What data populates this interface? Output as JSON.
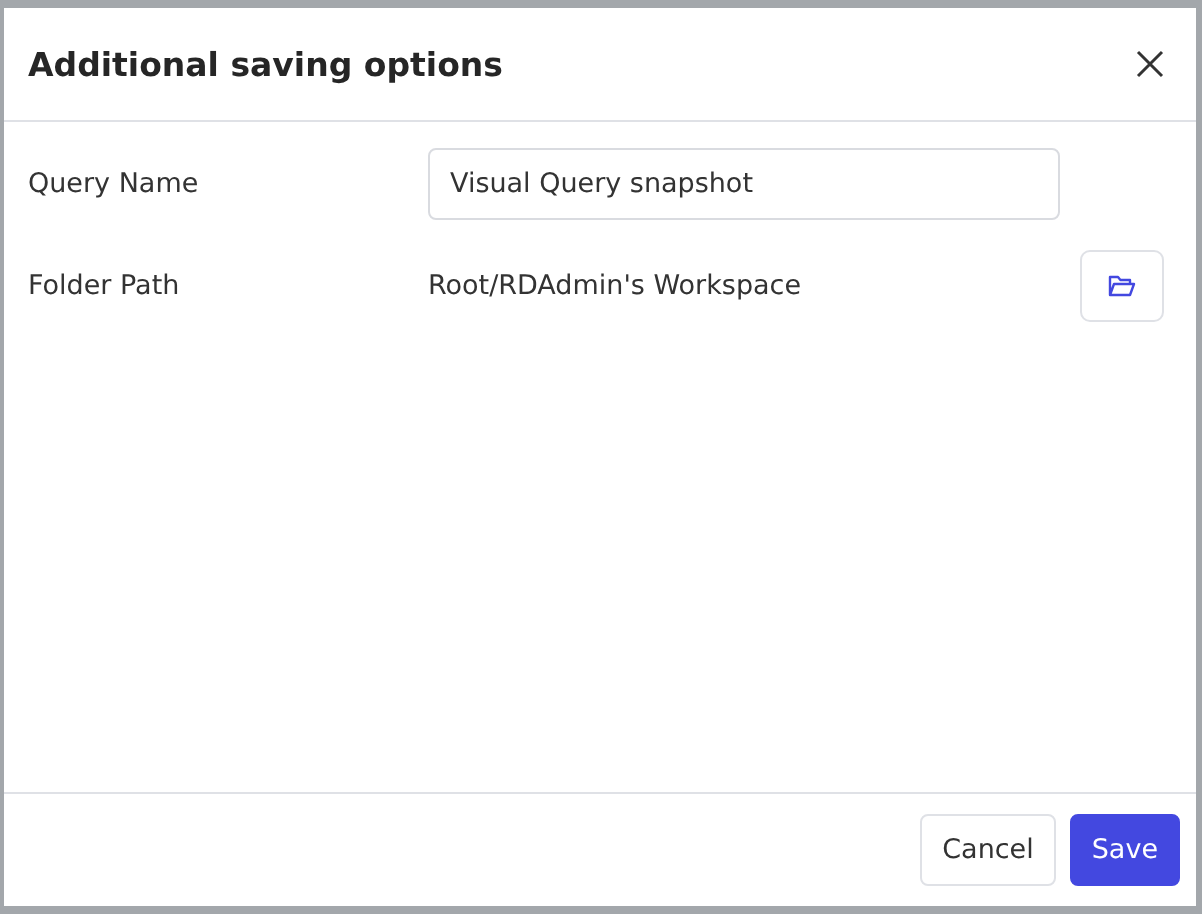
{
  "dialog": {
    "title": "Additional saving options"
  },
  "fields": [
    {
      "kind": "input",
      "label": "Query Name",
      "value": "Visual Query snapshot"
    },
    {
      "kind": "path",
      "label": "Folder Path",
      "value": "Root/RDAdmin's Workspace"
    }
  ],
  "buttons": [
    {
      "label": "Cancel",
      "primary": false
    },
    {
      "label": "Save",
      "primary": true
    }
  ]
}
